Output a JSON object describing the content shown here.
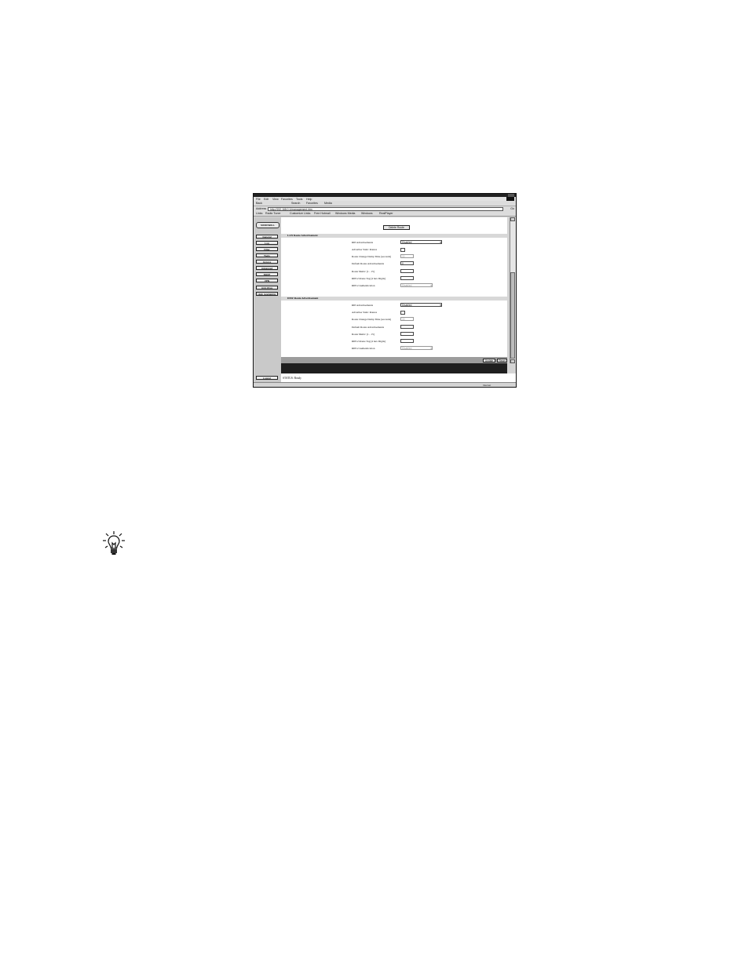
{
  "browser": {
    "menu": [
      "File",
      "Edit",
      "View",
      "Favorites",
      "Tools",
      "Help"
    ],
    "toolbar": [
      "Back",
      "Search",
      "Favorites",
      "Media"
    ],
    "address_label": "Address",
    "address_value": "http://192.168.0.1/management.htm",
    "go_label": "Go",
    "links_label": "Links",
    "links": [
      "Radio Tuner",
      "Customize Links",
      "Free Hotmail",
      "Windows Media",
      "Windows",
      "RealPlayer"
    ],
    "status_left": "",
    "status_zone": "Internet"
  },
  "sidebar": {
    "logo": "SONICWALL",
    "items": [
      "General",
      "Log",
      "Filter",
      "Tools",
      "Access",
      "Advanced",
      "DHCP",
      "VPN",
      "Anti-Virus",
      "High Availability"
    ],
    "logout": "Logout"
  },
  "main": {
    "delete_route_button": "Delete Route",
    "lan_section": {
      "title": "LAN Route Advertisement",
      "rows": [
        {
          "label": "RIP Advertisements",
          "kind": "select",
          "value": "Disabled",
          "disabled": false
        },
        {
          "label": "Advertise Static Routes",
          "kind": "checkbox",
          "value": ""
        },
        {
          "label": "Route Change Damp Time (seconds)",
          "kind": "input",
          "value": "30",
          "disabled": true
        },
        {
          "label": "Default Route Advertisements",
          "kind": "input",
          "value": "0",
          "disabled": false
        },
        {
          "label": "Route Metric (1 - 15)",
          "kind": "input",
          "value": "",
          "disabled": false
        },
        {
          "label": "RIPv2 Route Tag (4 hex Digits)",
          "kind": "input",
          "value": "",
          "disabled": false
        },
        {
          "label": "RIPv2 Authentication",
          "kind": "select",
          "value": "Disabled",
          "disabled": true
        }
      ]
    },
    "wan_section": {
      "title": "DMZ Route Advertisement",
      "rows": [
        {
          "label": "RIP Advertisements",
          "kind": "select",
          "value": "Disabled",
          "disabled": false
        },
        {
          "label": "Advertise Static Routes",
          "kind": "checkbox",
          "value": ""
        },
        {
          "label": "Route Change Damp Time (seconds)",
          "kind": "input",
          "value": "30",
          "disabled": true
        },
        {
          "label": "Default Route Advertisements",
          "kind": "input",
          "value": "",
          "disabled": false
        },
        {
          "label": "Route Metric (1 - 15)",
          "kind": "input",
          "value": "",
          "disabled": false
        },
        {
          "label": "RIPv2 Route Tag (4 hex Digits)",
          "kind": "input",
          "value": "",
          "disabled": false
        },
        {
          "label": "RIPv2 Authentication",
          "kind": "select",
          "value": "Disabled",
          "disabled": true
        }
      ]
    },
    "update_button": "Update",
    "reset_button": "Reset",
    "status_text": "STATUS: Ready"
  }
}
